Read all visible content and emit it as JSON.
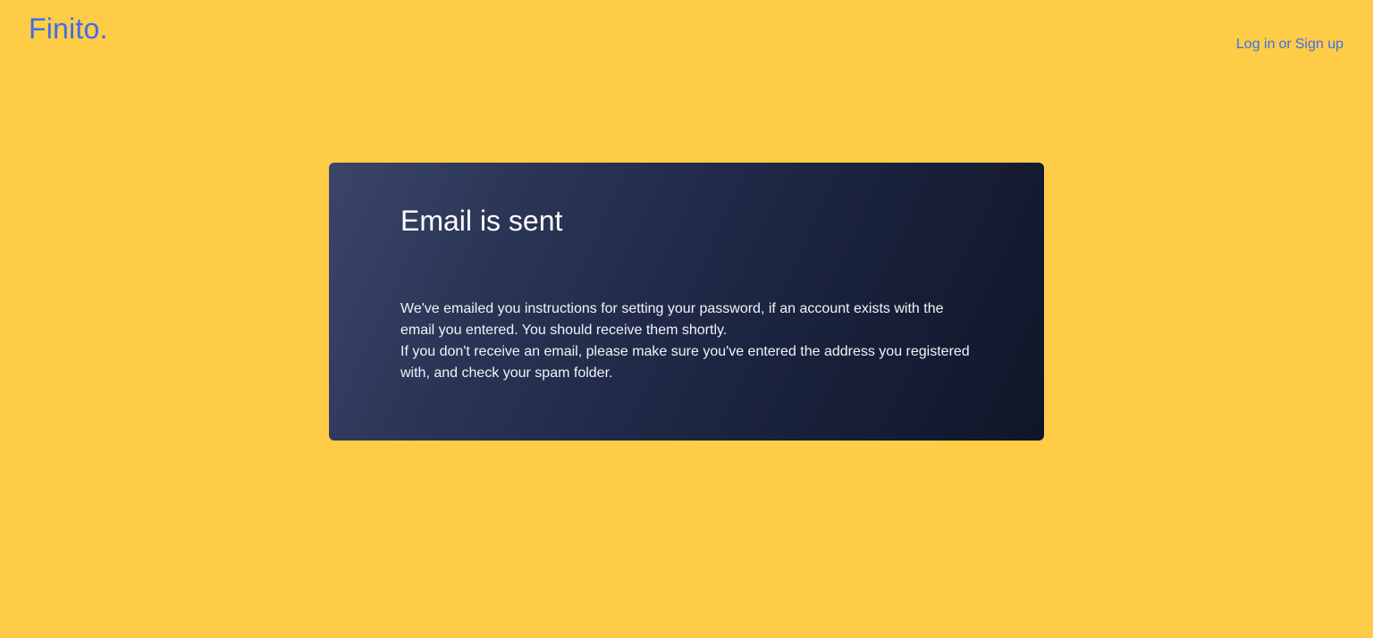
{
  "header": {
    "brand": "Finito.",
    "auth": {
      "login_label": "Log in",
      "separator": "or",
      "signup_label": "Sign up"
    }
  },
  "card": {
    "title": "Email is sent",
    "paragraph_1": "We've emailed you instructions for setting your password, if an account exists with the email you entered. You should receive them shortly.",
    "paragraph_2": "If you don't receive an email, please make sure you've entered the address you registered with, and check your spam folder."
  },
  "colors": {
    "background": "#FFCC47",
    "accent": "#3D6FE8",
    "card_gradient_start": "#3A4568",
    "card_gradient_end": "#101628",
    "card_text": "#FFFFFF"
  }
}
